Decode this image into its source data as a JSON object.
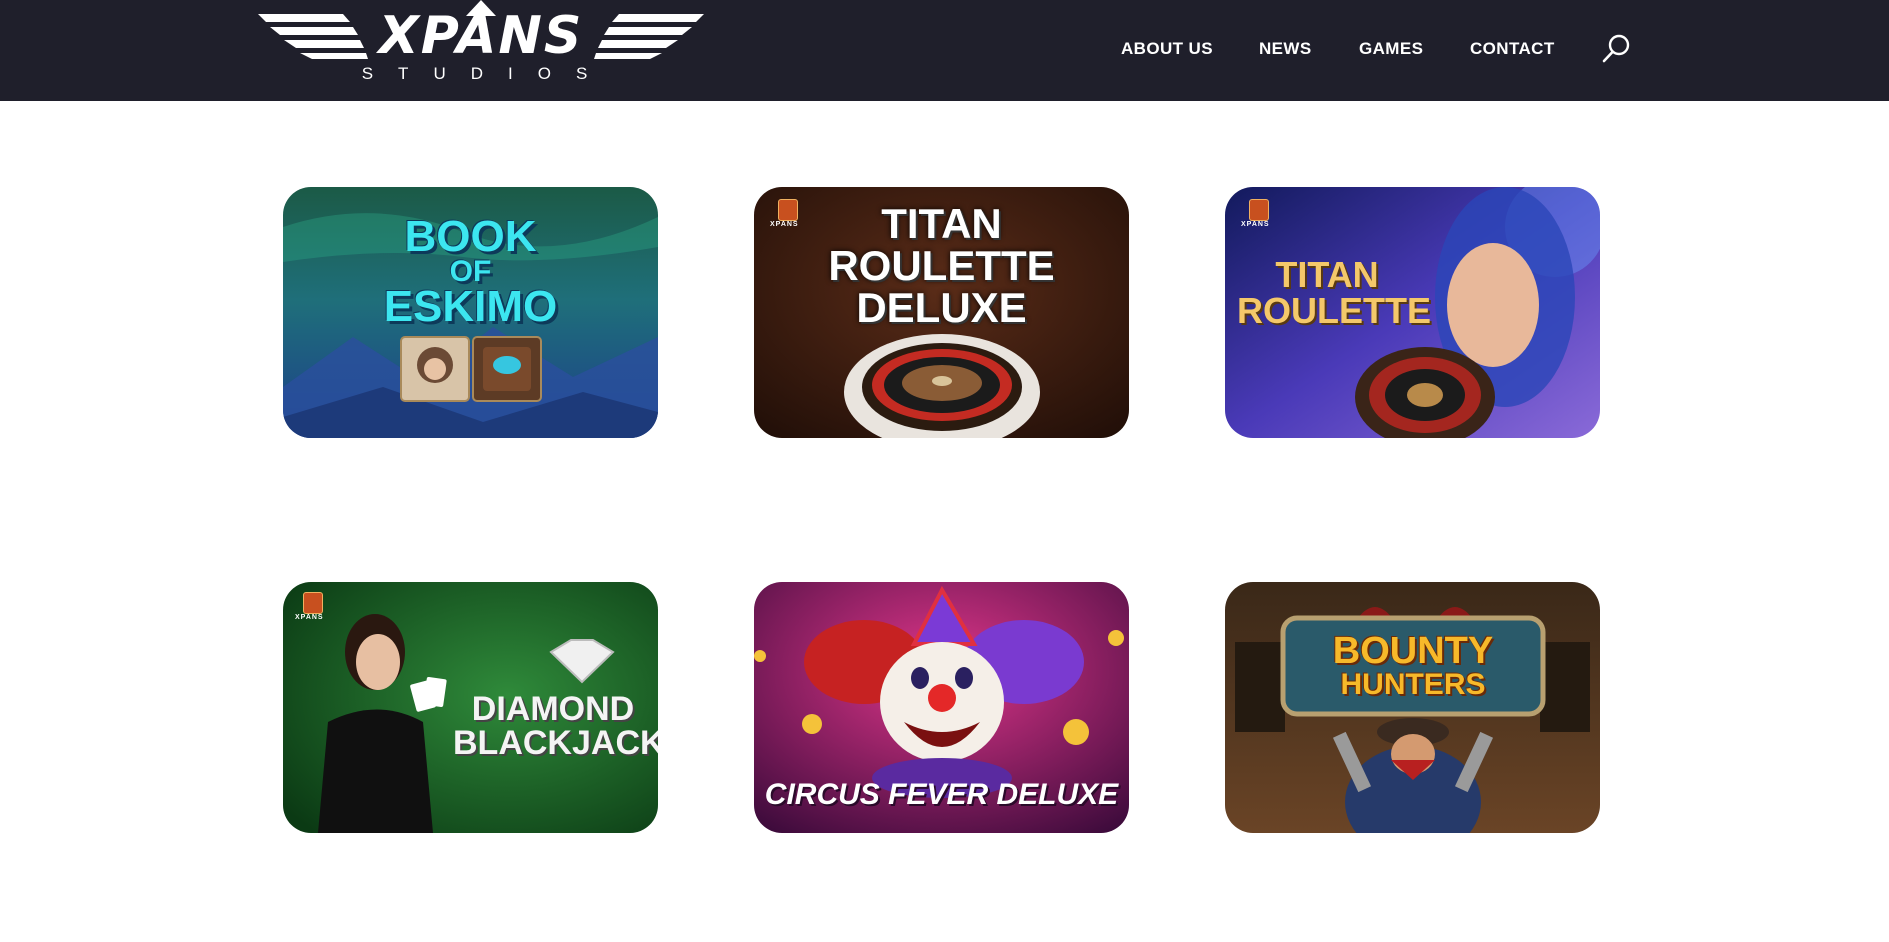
{
  "header": {
    "logo_text": "XPANS",
    "logo_subtitle": "STUDIOS",
    "nav": [
      {
        "label": "ABOUT US"
      },
      {
        "label": "NEWS"
      },
      {
        "label": "GAMES"
      },
      {
        "label": "CONTACT"
      }
    ],
    "search_icon": "search-icon"
  },
  "games": [
    {
      "title_lines": [
        "BOOK",
        "OF",
        "ESKIMO"
      ]
    },
    {
      "title_lines": [
        "TITAN",
        "ROULETTE",
        "DELUXE"
      ],
      "badge": "XPANS"
    },
    {
      "title_lines": [
        "TITAN",
        "ROULETTE"
      ],
      "badge": "XPANS"
    },
    {
      "title_lines": [
        "DIAMOND",
        "BLACKJACK"
      ],
      "badge": "XPANS"
    },
    {
      "title_lines": [
        "CIRCUS FEVER DELUXE"
      ]
    },
    {
      "title_lines": [
        "BOUNTY",
        "HUNTERS"
      ]
    }
  ],
  "colors": {
    "header_bg": "#1f1f2b",
    "page_bg": "#ffffff"
  }
}
